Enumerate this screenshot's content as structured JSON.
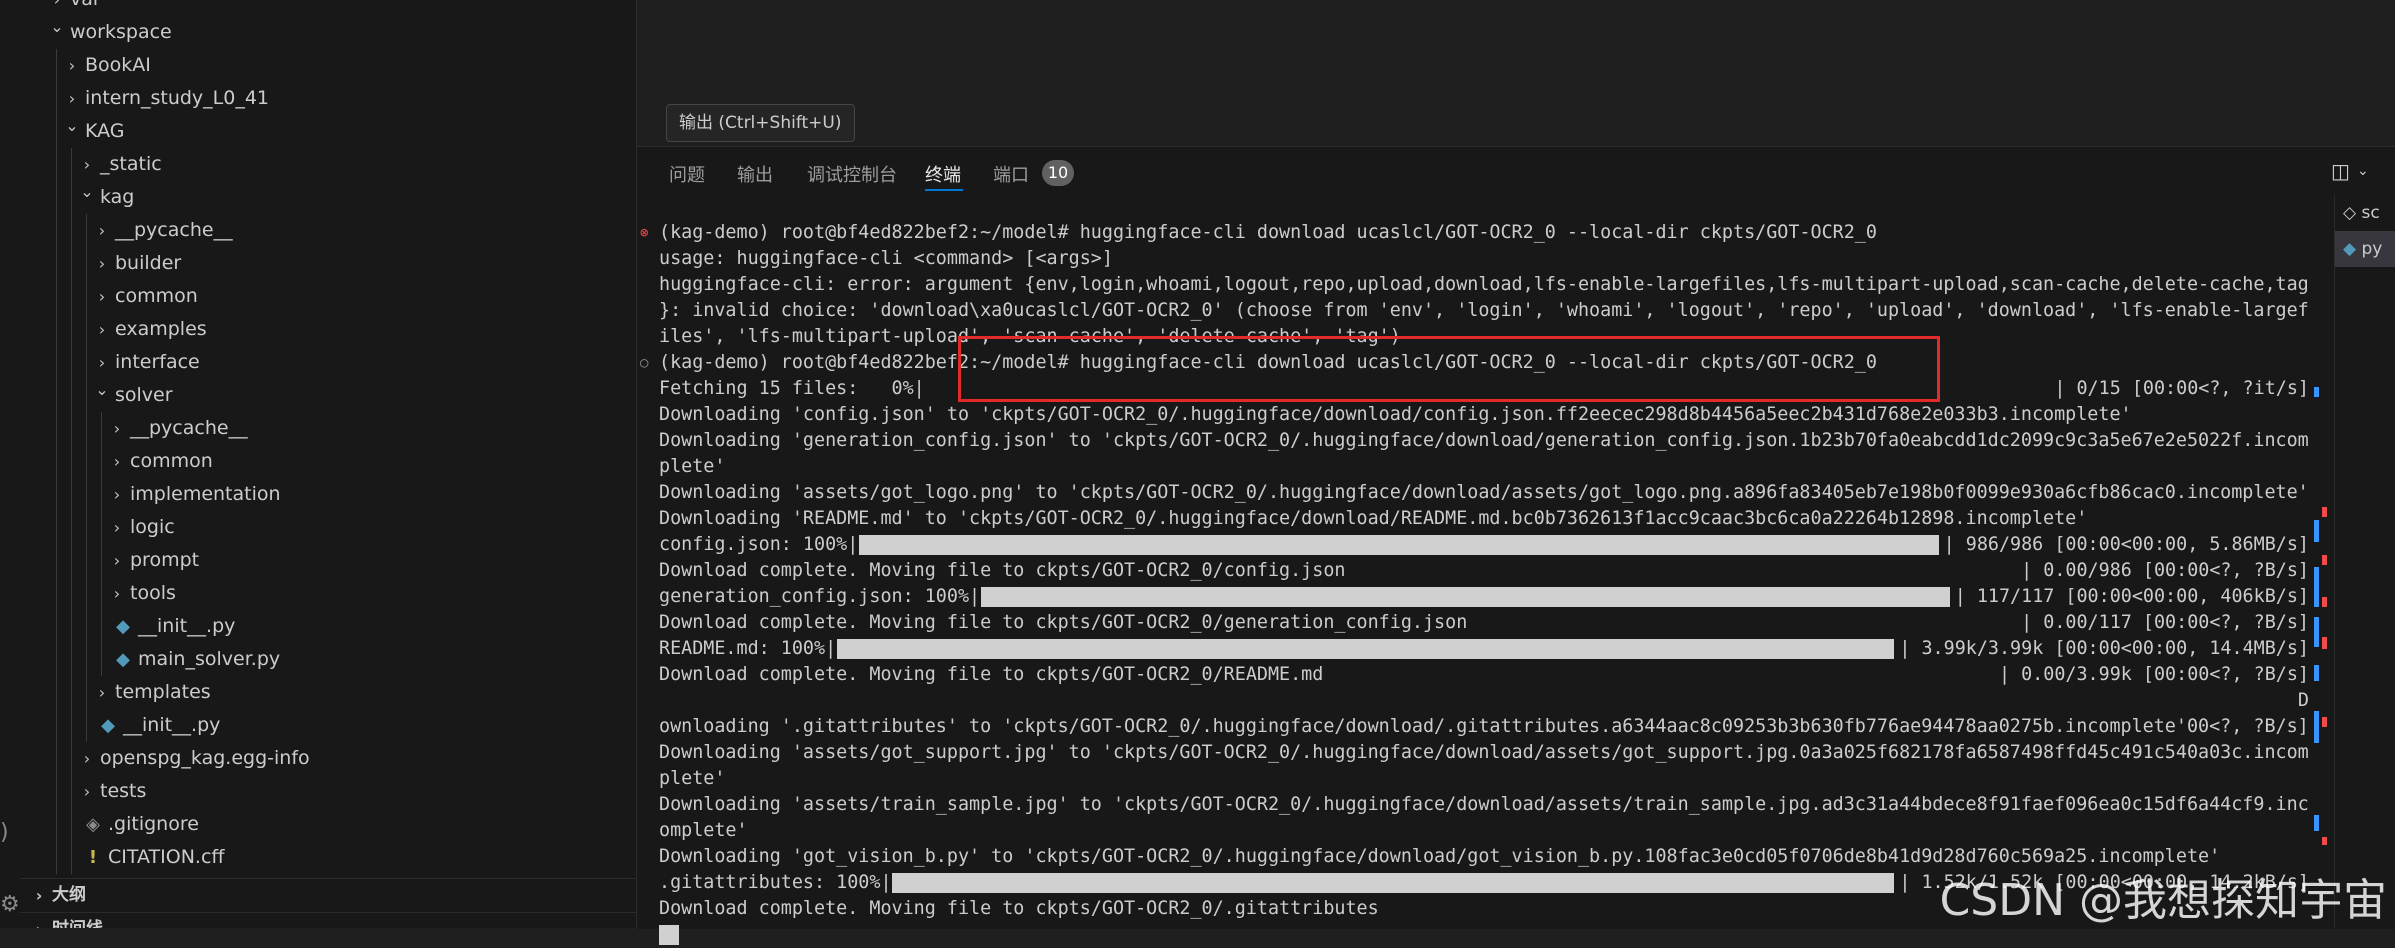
{
  "sidebar": {
    "tree": [
      {
        "label": "var",
        "type": "folder",
        "open": false,
        "depth": 0
      },
      {
        "label": "workspace",
        "type": "folder",
        "open": true,
        "depth": 0
      },
      {
        "label": "BookAI",
        "type": "folder",
        "open": false,
        "depth": 1
      },
      {
        "label": "intern_study_L0_41",
        "type": "folder",
        "open": false,
        "depth": 1
      },
      {
        "label": "KAG",
        "type": "folder",
        "open": true,
        "depth": 1
      },
      {
        "label": "_static",
        "type": "folder",
        "open": false,
        "depth": 2
      },
      {
        "label": "kag",
        "type": "folder",
        "open": true,
        "depth": 2
      },
      {
        "label": "__pycache__",
        "type": "folder",
        "open": false,
        "depth": 3
      },
      {
        "label": "builder",
        "type": "folder",
        "open": false,
        "depth": 3
      },
      {
        "label": "common",
        "type": "folder",
        "open": false,
        "depth": 3
      },
      {
        "label": "examples",
        "type": "folder",
        "open": false,
        "depth": 3
      },
      {
        "label": "interface",
        "type": "folder",
        "open": false,
        "depth": 3
      },
      {
        "label": "solver",
        "type": "folder",
        "open": true,
        "depth": 3
      },
      {
        "label": "__pycache__",
        "type": "folder",
        "open": false,
        "depth": 4
      },
      {
        "label": "common",
        "type": "folder",
        "open": false,
        "depth": 4
      },
      {
        "label": "implementation",
        "type": "folder",
        "open": false,
        "depth": 4
      },
      {
        "label": "logic",
        "type": "folder",
        "open": false,
        "depth": 4
      },
      {
        "label": "prompt",
        "type": "folder",
        "open": false,
        "depth": 4
      },
      {
        "label": "tools",
        "type": "folder",
        "open": false,
        "depth": 4
      },
      {
        "label": "__init__.py",
        "type": "py",
        "depth": 4
      },
      {
        "label": "main_solver.py",
        "type": "py",
        "depth": 4
      },
      {
        "label": "templates",
        "type": "folder",
        "open": false,
        "depth": 3
      },
      {
        "label": "__init__.py",
        "type": "py",
        "depth": 3
      },
      {
        "label": "openspg_kag.egg-info",
        "type": "folder",
        "open": false,
        "depth": 2
      },
      {
        "label": "tests",
        "type": "folder",
        "open": false,
        "depth": 2
      },
      {
        "label": ".gitignore",
        "type": "git",
        "depth": 2
      },
      {
        "label": "CITATION.cff",
        "type": "cff",
        "depth": 2
      }
    ],
    "sections": [
      "大纲",
      "时间线"
    ]
  },
  "tooltip": "输出 (Ctrl+Shift+U)",
  "panel": {
    "tabs": [
      {
        "label": "问题",
        "active": false
      },
      {
        "label": "输出",
        "active": false
      },
      {
        "label": "调试控制台",
        "active": false
      },
      {
        "label": "终端",
        "active": true
      },
      {
        "label": "端口",
        "active": false
      }
    ],
    "ports_badge": "10"
  },
  "terminal": {
    "lines": [
      {
        "text": "(kag-demo) root@bf4ed822bef2:~/model# huggingface-cli download ucaslcl/GOT-OCR2_0 --local-dir ckpts/GOT-OCR2_0",
        "deco": "err"
      },
      {
        "text": "usage: huggingface-cli <command> [<args>]"
      },
      {
        "text": "huggingface-cli: error: argument {env,login,whoami,logout,repo,upload,download,lfs-enable-largefiles,lfs-multipart-upload,scan-cache,delete-cache,tag"
      },
      {
        "text": "}: invalid choice: 'download\\xa0ucaslcl/GOT-OCR2_0' (choose from 'env', 'login', 'whoami', 'logout', 'repo', 'upload', 'download', 'lfs-enable-largef"
      },
      {
        "text": "iles', 'lfs-multipart-upload', 'scan-cache', 'delete-cache', 'tag')"
      },
      {
        "text": "(kag-demo) root@bf4ed822bef2:~/model# huggingface-cli download ucaslcl/GOT-OCR2_0 --local-dir ckpts/GOT-OCR2_0",
        "deco": "ok"
      },
      {
        "text": "Fetching 15 files:   0%|",
        "right": "| 0/15 [00:00<?, ?it/s]"
      },
      {
        "text": "Downloading 'config.json' to 'ckpts/GOT-OCR2_0/.huggingface/download/config.json.ff2eecec298d8b4456a5eec2b431d768e2e033b3.incomplete'"
      },
      {
        "text": "Downloading 'generation_config.json' to 'ckpts/GOT-OCR2_0/.huggingface/download/generation_config.json.1b23b70fa0eabcdd1dc2099c9c3a5e67e2e5022f.incom"
      },
      {
        "text": "plete'"
      },
      {
        "text": "Downloading 'assets/got_logo.png' to 'ckpts/GOT-OCR2_0/.huggingface/download/assets/got_logo.png.a896fa83405eb7e198b0f0099e930a6cfb86cac0.incomplete'"
      },
      {
        "text": "Downloading 'README.md' to 'ckpts/GOT-OCR2_0/.huggingface/download/README.md.bc0b7362613f1acc9caac3bc6ca0a22264b12898.incomplete'"
      },
      {
        "text": "config.json: 100%|",
        "bar": 1.0,
        "right": "| 986/986 [00:00<00:00, 5.86MB/s]"
      },
      {
        "text": "Download complete. Moving file to ckpts/GOT-OCR2_0/config.json",
        "right": "| 0.00/986 [00:00<?, ?B/s]"
      },
      {
        "text": "generation_config.json: 100%|",
        "bar": 1.0,
        "right": "| 117/117 [00:00<00:00, 406kB/s]"
      },
      {
        "text": "Download complete. Moving file to ckpts/GOT-OCR2_0/generation_config.json",
        "right": "| 0.00/117 [00:00<?, ?B/s]"
      },
      {
        "text": "README.md: 100%|",
        "bar": 1.0,
        "right": "| 3.99k/3.99k [00:00<00:00, 14.4MB/s]"
      },
      {
        "text": "Download complete. Moving file to ckpts/GOT-OCR2_0/README.md",
        "right": "| 0.00/3.99k [00:00<?, ?B/s]"
      },
      {
        "text": "",
        "right": "D"
      },
      {
        "text": "ownloading '.gitattributes' to 'ckpts/GOT-OCR2_0/.huggingface/download/.gitattributes.a6344aac8c09253b3b630fb776ae94478aa0275b.incomplete'00<?, ?B/s]"
      },
      {
        "text": "Downloading 'assets/got_support.jpg' to 'ckpts/GOT-OCR2_0/.huggingface/download/assets/got_support.jpg.0a3a025f682178fa6587498ffd45c491c540a03c.incom"
      },
      {
        "text": "plete'"
      },
      {
        "text": "Downloading 'assets/train_sample.jpg' to 'ckpts/GOT-OCR2_0/.huggingface/download/assets/train_sample.jpg.ad3c31a44bdece8f91faef096ea0c15df6a44cf9.inc"
      },
      {
        "text": "omplete'"
      },
      {
        "text": "Downloading 'got_vision_b.py' to 'ckpts/GOT-OCR2_0/.huggingface/download/got_vision_b.py.108fac3e0cd05f0706de8b41d9d28d760c569a25.incomplete'"
      },
      {
        "text": ".gitattributes: 100%|",
        "bar": 1.0,
        "right": "| 1.52k/1.52k [00:00<00:00, 14.2kB/s]"
      },
      {
        "text": "Download complete. Moving file to ckpts/GOT-OCR2_0/.gitattributes"
      },
      {
        "text": "",
        "bar": 0.2
      }
    ]
  },
  "right_tabs": [
    {
      "label": "sc",
      "active": false
    },
    {
      "label": "py",
      "active": true
    }
  ],
  "watermark": "CSDN @我想探知宇宙",
  "colors": {
    "accent": "#0078d4",
    "highlight": "#e22a2a",
    "error": "#f14c4c"
  }
}
